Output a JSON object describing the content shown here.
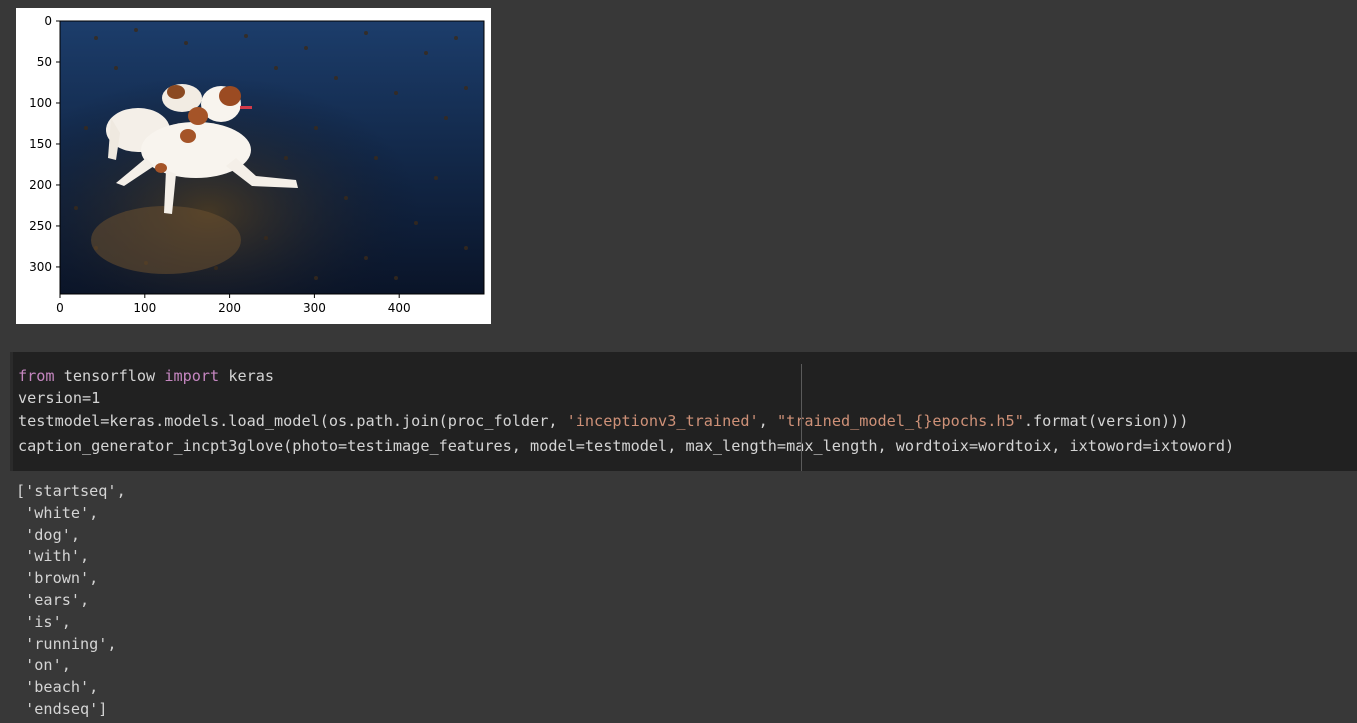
{
  "plot": {
    "x_ticks": [
      "0",
      "100",
      "200",
      "300",
      "400"
    ],
    "y_ticks": [
      "0",
      "50",
      "100",
      "150",
      "200",
      "250",
      "300"
    ],
    "image_desc": "dog-photo"
  },
  "code": {
    "line1": {
      "kw1": "from",
      "mod": " tensorflow ",
      "kw2": "import",
      "name": " keras"
    },
    "line2": "version=1",
    "line3": {
      "pre": "testmodel=keras.models.load_model(os.path.join(proc_folder, ",
      "str1": "'inceptionv3_trained'",
      "mid": ", ",
      "str2": "\"trained_model_{}epochs.h5\"",
      "post": ".format(version)))"
    },
    "line4": "caption_generator_incpt3glove(photo=testimage_features, model=testmodel, max_length=max_length, wordtoix=wordtoix, ixtoword=ixtoword)"
  },
  "output": {
    "lines": [
      "['startseq',",
      " 'white',",
      " 'dog',",
      " 'with',",
      " 'brown',",
      " 'ears',",
      " 'is',",
      " 'running',",
      " 'on',",
      " 'beach',",
      " 'endseq']"
    ]
  }
}
